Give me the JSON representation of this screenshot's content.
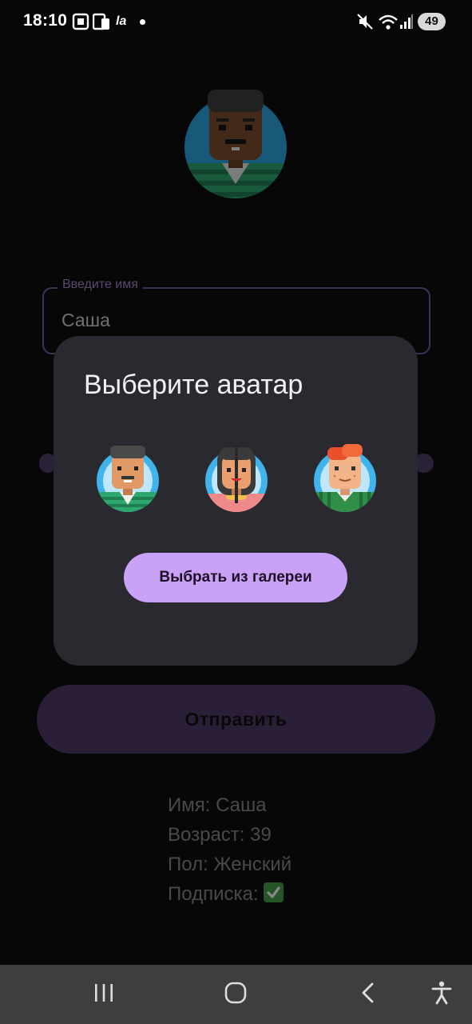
{
  "status_bar": {
    "time": "18:10",
    "carrier_badge": "la",
    "battery": "49",
    "icons": [
      "screenshot-icon",
      "device-icon",
      "mute-icon",
      "wifi-icon",
      "signal-icon"
    ]
  },
  "form": {
    "name_label": "Введите имя",
    "name_value": "Саша",
    "submit_label": "Отправить"
  },
  "summary": {
    "name_line": "Имя: Саша",
    "age_line": "Возраст: 39",
    "gender_line": "Пол: Женский",
    "subscription_line": "Подписка: ",
    "subscription_icon": "check-mark-icon"
  },
  "dialog": {
    "title": "Выберите аватар",
    "avatar_options": [
      "avatar-man-dark-hair",
      "avatar-woman-dark-hair",
      "avatar-man-red-hair"
    ],
    "gallery_button_label": "Выбрать из галереи"
  },
  "colors": {
    "background": "#070708",
    "dialog_surface": "#2b2930",
    "primary": "#c9a1f7",
    "submit_button": "#4e3766",
    "field_outline": "#7a5a9f",
    "nav_bar": "#3e3e3e"
  },
  "nav_bar": {
    "icons": [
      "recent-apps-icon",
      "home-icon",
      "back-icon",
      "accessibility-icon"
    ]
  }
}
